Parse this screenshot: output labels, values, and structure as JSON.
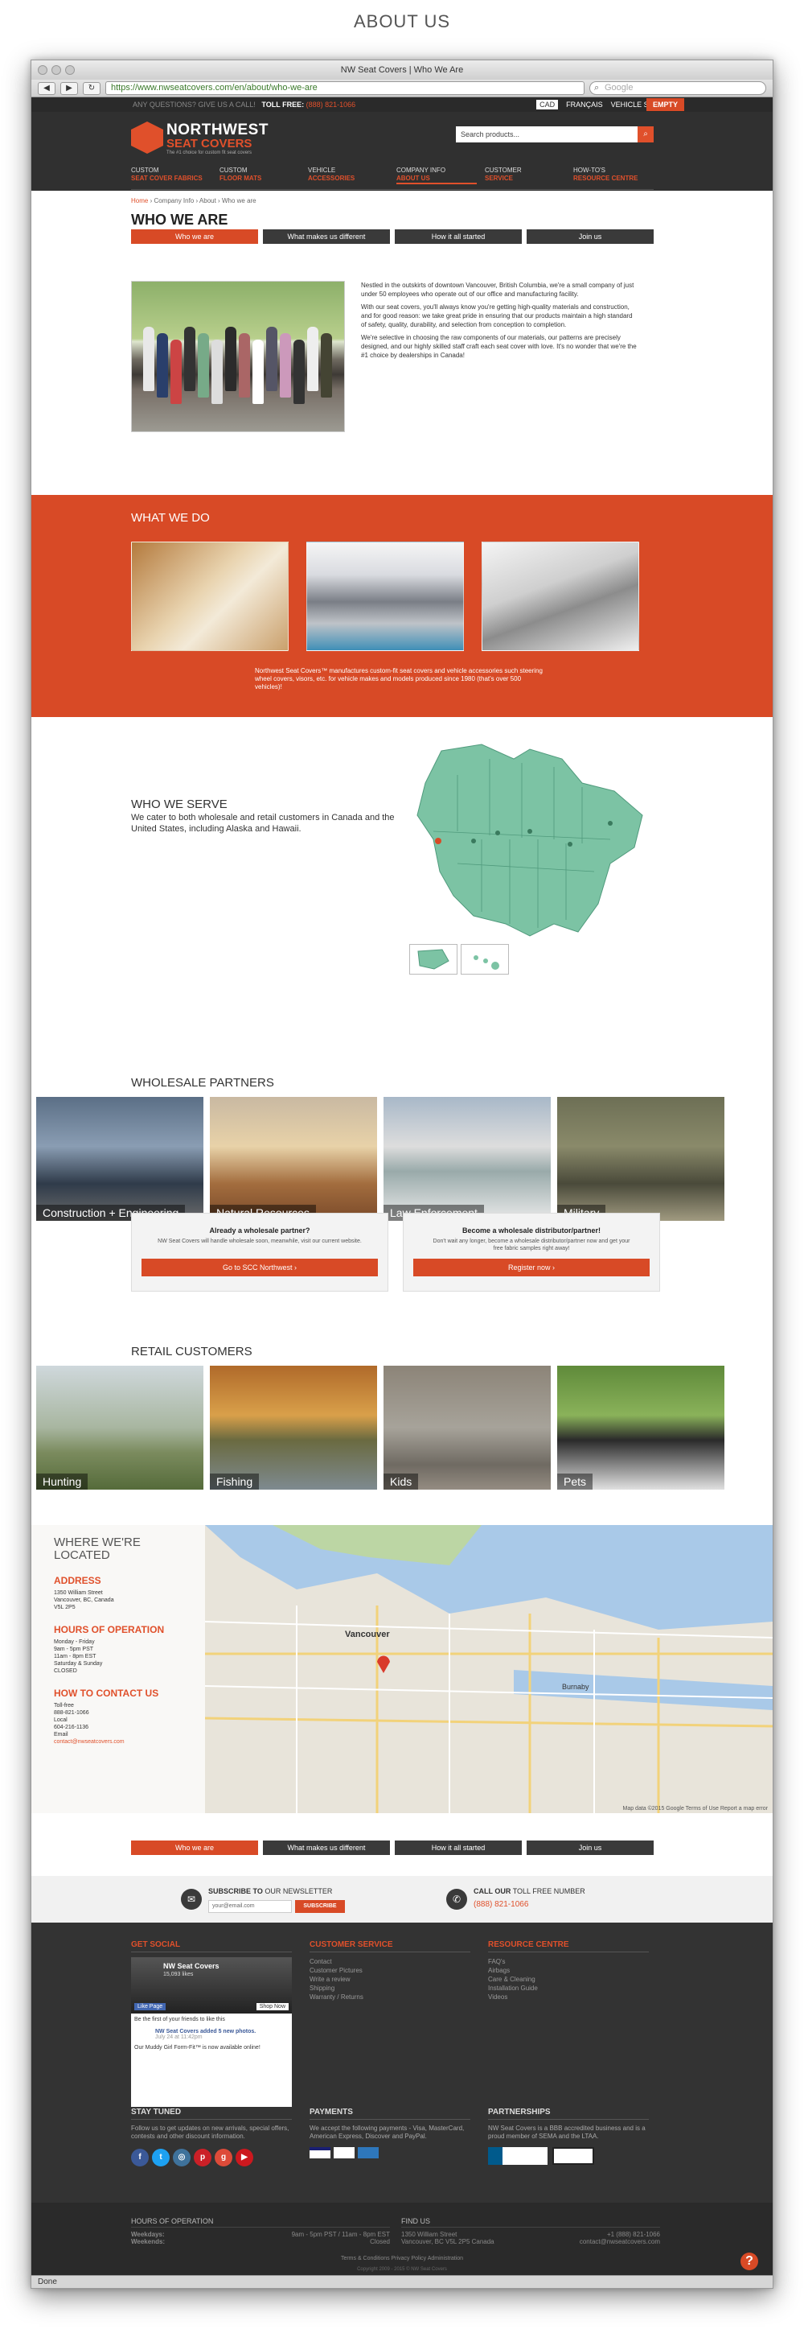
{
  "page_heading": "ABOUT US",
  "browser": {
    "title": "NW Seat Covers  |  Who We Are",
    "url": "https://www.nwseatcovers.com/en/about/who-we-are",
    "search_placeholder": "Google",
    "status": "Done"
  },
  "topbar": {
    "question": "ANY QUESTIONS? GIVE US A CALL!",
    "tollfree_label": "TOLL FREE:",
    "tollfree": "(888) 821-1066",
    "currency": "CAD",
    "lang": "FRANÇAIS",
    "vehicle": "VEHICLE SELECTOR",
    "cart": "EMPTY"
  },
  "logo": {
    "line1": "NORTHWEST",
    "line2": "SEAT COVERS",
    "tagline": "The #1 choice for custom fit seat covers"
  },
  "search": {
    "placeholder": "Search products..."
  },
  "menu": [
    {
      "top": "CUSTOM",
      "main": "SEAT COVER FABRICS"
    },
    {
      "top": "CUSTOM",
      "main": "FLOOR MATS"
    },
    {
      "top": "VEHICLE",
      "main": "ACCESSORIES"
    },
    {
      "top": "COMPANY INFO",
      "main": "ABOUT US"
    },
    {
      "top": "CUSTOMER",
      "main": "SERVICE"
    },
    {
      "top": "HOW-TO'S",
      "main": "RESOURCE CENTRE"
    }
  ],
  "breadcrumb": {
    "home": "Home",
    "rest": " › Company Info › About › Who we are"
  },
  "title": "WHO WE ARE",
  "tabs": [
    "Who we are",
    "What makes us different",
    "How it all started",
    "Join us"
  ],
  "intro": [
    "Nestled in the outskirts of downtown Vancouver, British Columbia, we're a small company of just under 50 employees who operate out of our office and manufacturing facility.",
    "With our seat covers, you'll always know you're getting high-quality materials and construction, and for good reason: we take great pride in ensuring that our products maintain a high standard of safety, quality, durability, and selection from conception to completion.",
    "We're selective in choosing the raw components of our materials, our patterns are precisely designed, and our highly skilled staff craft each seat cover with love. It's no wonder that we're the #1 choice by dealerships in Canada!"
  ],
  "what_we_do": {
    "heading": "WHAT WE DO",
    "caption": "Northwest Seat Covers™ manufactures custom-fit seat covers and vehicle accessories such steering wheel covers, visors, etc. for vehicle makes and models produced since 1980 (that's over 500 vehicles)!"
  },
  "who_we_serve": {
    "heading": "WHO WE SERVE",
    "text": "We cater to both wholesale and retail customers in Canada and the United States, including Alaska and Hawaii."
  },
  "wholesale": {
    "heading": "WHOLESALE PARTNERS",
    "tiles": [
      "Construction + Engineering",
      "Natural Resources",
      "Law Enforcement",
      "Military"
    ]
  },
  "partner_box": {
    "title": "Already a wholesale partner?",
    "text": "NW Seat Covers will handle wholesale soon, meanwhile, visit our current website.",
    "button": "Go to SCC Northwest ›"
  },
  "distrib_box": {
    "title": "Become a wholesale distributor/partner!",
    "text": "Don't wait any longer, become a wholesale distributor/partner now and get your free fabric samples right away!",
    "button": "Register now ›"
  },
  "retail": {
    "heading": "RETAIL CUSTOMERS",
    "tiles": [
      "Hunting",
      "Fishing",
      "Kids",
      "Pets"
    ]
  },
  "location": {
    "heading": "WHERE WE'RE LOCATED",
    "address_h": "ADDRESS",
    "address": [
      "1350 William Street",
      "Vancouver, BC, Canada",
      "V5L 2P5"
    ],
    "hours_h": "HOURS OF OPERATION",
    "hours": [
      "Monday - Friday",
      "9am - 5pm PST",
      "11am - 8pm EST",
      "Saturday & Sunday",
      "CLOSED"
    ],
    "contact_h": "HOW TO CONTACT US",
    "contact": [
      "Toll-free",
      "888-821-1066",
      "Local",
      "604-216-1136",
      "Email"
    ],
    "email": "contact@nwseatcovers.com",
    "map_city": "Vancouver",
    "map_credit": "Map data ©2015 Google   Terms of Use   Report a map error",
    "burnaby": "Burnaby"
  },
  "newsletter": {
    "label": "SUBSCRIBE TO",
    "label2": "OUR NEWSLETTER",
    "placeholder": "your@email.com",
    "button": "SUBSCRIBE",
    "call": "CALL OUR",
    "call2": "TOLL FREE NUMBER",
    "phone": "(888) 821-1066"
  },
  "footer": {
    "social_h": "GET SOCIAL",
    "fb_name": "NW Seat Covers",
    "fb_likes": "15,093 likes",
    "fb_like": "Like Page",
    "fb_shop": "Shop Now",
    "fb_friends": "Be the first of your friends to like this",
    "fb_post": "NW Seat Covers added 5 new photos.",
    "fb_time": "July 24 at 11:42pm",
    "fb_caption": "Our Muddy Girl Form-Fit™ is now available online!",
    "cs_h": "CUSTOMER SERVICE",
    "cs": [
      "Contact",
      "Customer Pictures",
      "Write a review",
      "Shipping",
      "Warranty / Returns"
    ],
    "rc_h": "RESOURCE CENTRE",
    "rc": [
      "FAQ's",
      "Airbags",
      "Care & Cleaning",
      "Installation Guide",
      "Videos"
    ],
    "tuned_h": "STAY TUNED",
    "tuned": "Follow us to get updates on new arrivals, special offers, contests and other discount information.",
    "pay_h": "PAYMENTS",
    "pay": "We accept the following payments - Visa, MasterCard, American Express, Discover and PayPal.",
    "part_h": "PARTNERSHIPS",
    "part": "NW Seat Covers is a BBB accredited business and is a proud member of SEMA and the LTAA.",
    "hours_h": "HOURS OF OPERATION",
    "weekdays_l": "Weekdays:",
    "weekdays": "9am - 5pm PST / 11am - 8pm EST",
    "weekends_l": "Weekends:",
    "weekends": "Closed",
    "find_h": "FIND US",
    "find1": "1350 William Street",
    "find2": "Vancouver, BC V5L 2P5 Canada",
    "phone": "+1 (888) 821-1066",
    "email": "contact@nwseatcovers.com",
    "links": "Terms & Conditions    Privacy Policy    Administration",
    "copy": "Copyright 2009 - 2015 © NW Seat Covers"
  },
  "colors": {
    "accent": "#d84a26",
    "dark": "#303030",
    "map_green": "#7cc3a4"
  }
}
